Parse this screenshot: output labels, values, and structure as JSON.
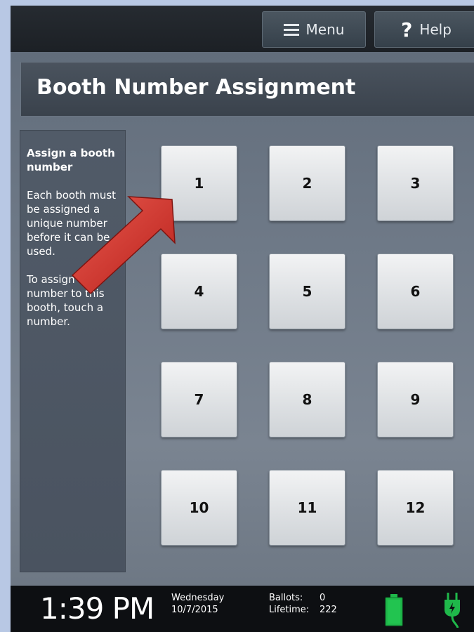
{
  "header": {
    "menu_label": "Menu",
    "help_label": "Help"
  },
  "page": {
    "title": "Booth Number Assignment"
  },
  "sidebar": {
    "heading": "Assign a booth number",
    "paragraph1": "Each booth must be assigned a unique number before it can be used.",
    "paragraph2": "To assign a number to this booth, touch a number."
  },
  "booth_buttons": [
    "1",
    "2",
    "3",
    "4",
    "5",
    "6",
    "7",
    "8",
    "9",
    "10",
    "11",
    "12"
  ],
  "status": {
    "time": "1:39 PM",
    "day": "Wednesday",
    "date": "10/7/2015",
    "ballots_label": "Ballots:",
    "ballots_value": "0",
    "lifetime_label": "Lifetime:",
    "lifetime_value": "222"
  },
  "icons": {
    "menu": "hamburger-icon",
    "help": "question-mark-icon",
    "battery": "battery-icon",
    "power": "power-plug-icon",
    "annotation": "red-arrow-pointer"
  },
  "colors": {
    "battery_green": "#1fb84a",
    "annotation_red": "#d9312b"
  }
}
